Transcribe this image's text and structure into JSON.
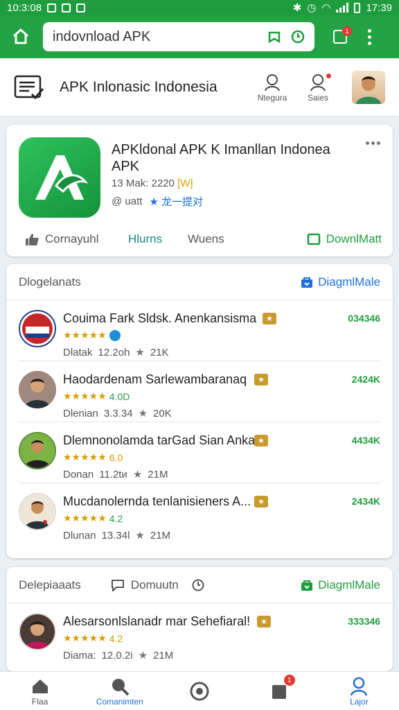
{
  "status_bar": {
    "time_left": "10:3:08",
    "time_right": "17:39"
  },
  "browser": {
    "url": "indovnload APK",
    "tab_count": "1"
  },
  "site": {
    "title": "APK Inlonasic Indonesia",
    "btn_navigation": "Ntegura",
    "btn_search": "Saies"
  },
  "app": {
    "title": "APKldonal APK K Imanllan Indonea APK",
    "meta_prefix": "13 Mak: ",
    "meta_year": "2220",
    "meta_highlight": "[W]",
    "author": "@ uatt",
    "rating_text": "★ 龙一提对",
    "actions": {
      "community": "Cornayuhl",
      "items": "Hlurns",
      "wuens": "Wuens",
      "download": "DownlMatt"
    }
  },
  "section1": {
    "title": "Dlogelanats",
    "link": "DiagmlMale",
    "rows": [
      {
        "title": "Couima Fark Sldsk. Anenkansisma",
        "rating": "★★★★★",
        "rating_value": "",
        "info_label": "Dlatak",
        "info_time": "12.2oh",
        "info_count": "21K",
        "count": "034346",
        "avatar_color": "#c62828"
      },
      {
        "title": "Haodardenam Sarlewambaranaq",
        "rating": "★★★★★",
        "rating_value": "4.0D",
        "info_label": "Dlenian",
        "info_time": "3.3.34",
        "info_count": "20K",
        "count": "2424K",
        "avatar_color": "#5d4037"
      },
      {
        "title": "Dlemnonolamda tarGad Sian Ankar..",
        "rating": "★★★★★",
        "rating_value": "6.0",
        "info_label": "Donan",
        "info_time": "11.2tи",
        "info_count": "21M",
        "count": "4434K",
        "avatar_color": "#33691e"
      },
      {
        "title": "Mucdanolernda tenlanisieners A...",
        "rating": "★★★★★",
        "rating_value": "4.2",
        "info_label": "Dlunan",
        "info_time": "13.34l",
        "info_count": "21M",
        "count": "2434K",
        "avatar_color": "#4e342e"
      }
    ]
  },
  "section2": {
    "title": "Delepiaaats",
    "tab_label": "Domuutn",
    "link": "DiagmlMale",
    "rows": [
      {
        "title": "Alesarsonlslanadr mar Sehefiaral!",
        "rating": "★★★★★",
        "rating_value": "4.2",
        "info_label": "Diama:",
        "info_time": "12.0.2і",
        "info_count": "21M",
        "count": "333346",
        "avatar_color": "#3e2723"
      }
    ]
  },
  "bottom_nav": {
    "home": "Flaa",
    "community": "Comanimten",
    "center": "",
    "inbox": "",
    "inbox_badge": "1",
    "profile": "Lajor"
  },
  "colors": {
    "brand_green": "#23a344",
    "link_blue": "#1d6fd6",
    "rating_gold": "#d4a000"
  }
}
